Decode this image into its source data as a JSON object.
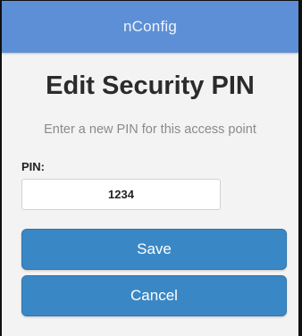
{
  "header": {
    "title": "nConfig"
  },
  "page": {
    "title": "Edit Security PIN",
    "subtitle": "Enter a new PIN for this access point"
  },
  "form": {
    "pin_label": "PIN:",
    "pin_value": "1234"
  },
  "buttons": {
    "save_label": "Save",
    "cancel_label": "Cancel"
  },
  "colors": {
    "header_bg": "#5d8fd6",
    "button_bg": "#3a87c5",
    "page_bg": "#f3f3f3"
  }
}
